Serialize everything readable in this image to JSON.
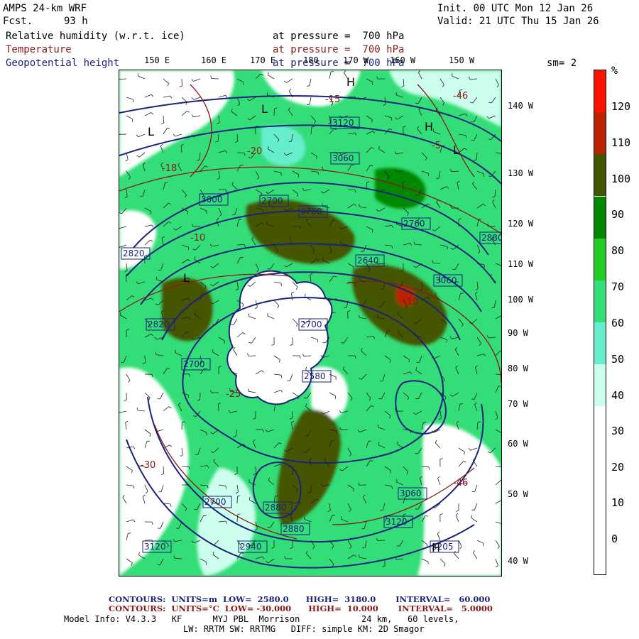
{
  "header": {
    "model": "AMPS 24-km WRF",
    "fcst_label": "Fcst.",
    "fcst_value": "93 h",
    "init": "Init. 00 UTC Mon 12 Jan 26",
    "valid": "Valid: 21 UTC Thu 15 Jan 26",
    "field1": "Relative humidity (w.r.t. ice)",
    "field1_level": "at pressure =  700 hPa",
    "field2": "Temperature",
    "field2_level": "at pressure =  700 hPa",
    "field3": "Geopotential height",
    "field3_level": "at pressure =  700 hPa",
    "smoothing": "sm= 2"
  },
  "colors": {
    "rh_shading": [
      "#ffffff",
      "#ffffff",
      "#ffffff",
      "#ffffff",
      "#ccffee",
      "#66eecc",
      "#33dd77",
      "#22cc22",
      "#008800",
      "#445500",
      "#bb2200",
      "#ff1100"
    ],
    "height_contours": "#1a237e",
    "temperature_contours": "#8b1a1a"
  },
  "map": {
    "lon_labels": [
      "150 E",
      "160 E",
      "170 E",
      "180",
      "170 W",
      "160 W",
      "150 W"
    ],
    "lat_labels": [
      "140 W",
      "130 W",
      "120 W",
      "110 W",
      "100 W",
      "90 W",
      "80 W",
      "70 W",
      "60 W",
      "50 W",
      "40 W"
    ],
    "height_labels": [
      "3120",
      "3060",
      "3000",
      "2940",
      "2880",
      "2820",
      "2760",
      "2700",
      "2640",
      "2580",
      "3205"
    ],
    "temp_labels": [
      "-10",
      "-5",
      "-15",
      "-20",
      "-25",
      "-30",
      "-18",
      "-46"
    ],
    "high_low_markers": [
      "H",
      "L"
    ]
  },
  "colorbar": {
    "unit": "%",
    "labels": [
      "120",
      "110",
      "100",
      "90",
      "80",
      "70",
      "60",
      "50",
      "40",
      "30",
      "20",
      "10",
      "0"
    ]
  },
  "footer": {
    "contour1": "CONTOURS:  UNITS=m  LOW=  2580.0      HIGH=  3180.0       INTERVAL=   60.000",
    "contour2": "CONTOURS:  UNITS=°C  LOW= -30.000      HIGH=  10.000       INTERVAL=   5.0000",
    "model_info": "Model Info: V4.3.3   KF      MYJ PBL  Morrison            24 km,   60 levels,",
    "physics": "LW: RRTM SW: RRTMG   DIFF: simple KM: 2D Smagor"
  }
}
